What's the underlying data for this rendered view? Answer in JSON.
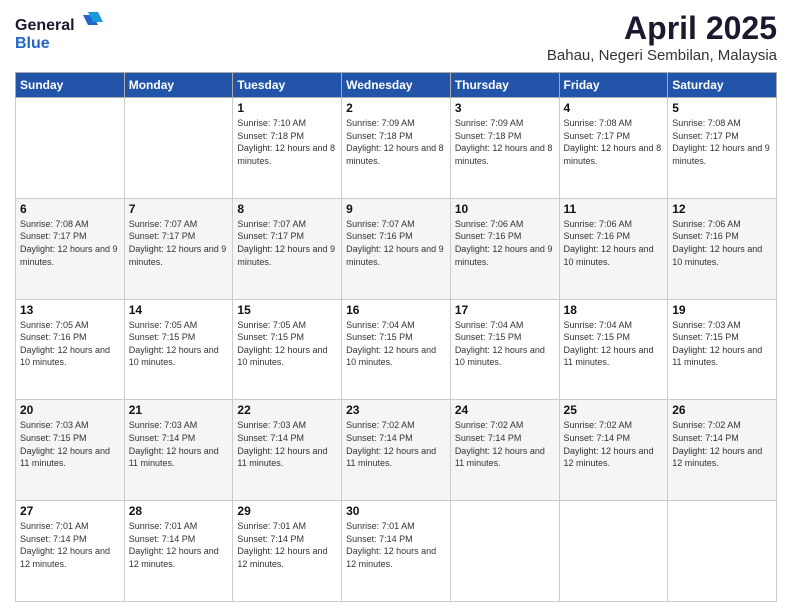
{
  "header": {
    "logo": {
      "general": "General",
      "blue": "Blue"
    },
    "title": "April 2025",
    "subtitle": "Bahau, Negeri Sembilan, Malaysia"
  },
  "calendar": {
    "days_of_week": [
      "Sunday",
      "Monday",
      "Tuesday",
      "Wednesday",
      "Thursday",
      "Friday",
      "Saturday"
    ],
    "weeks": [
      [
        {
          "day": "",
          "detail": ""
        },
        {
          "day": "",
          "detail": ""
        },
        {
          "day": "1",
          "detail": "Sunrise: 7:10 AM\nSunset: 7:18 PM\nDaylight: 12 hours and 8 minutes."
        },
        {
          "day": "2",
          "detail": "Sunrise: 7:09 AM\nSunset: 7:18 PM\nDaylight: 12 hours and 8 minutes."
        },
        {
          "day": "3",
          "detail": "Sunrise: 7:09 AM\nSunset: 7:18 PM\nDaylight: 12 hours and 8 minutes."
        },
        {
          "day": "4",
          "detail": "Sunrise: 7:08 AM\nSunset: 7:17 PM\nDaylight: 12 hours and 8 minutes."
        },
        {
          "day": "5",
          "detail": "Sunrise: 7:08 AM\nSunset: 7:17 PM\nDaylight: 12 hours and 9 minutes."
        }
      ],
      [
        {
          "day": "6",
          "detail": "Sunrise: 7:08 AM\nSunset: 7:17 PM\nDaylight: 12 hours and 9 minutes."
        },
        {
          "day": "7",
          "detail": "Sunrise: 7:07 AM\nSunset: 7:17 PM\nDaylight: 12 hours and 9 minutes."
        },
        {
          "day": "8",
          "detail": "Sunrise: 7:07 AM\nSunset: 7:17 PM\nDaylight: 12 hours and 9 minutes."
        },
        {
          "day": "9",
          "detail": "Sunrise: 7:07 AM\nSunset: 7:16 PM\nDaylight: 12 hours and 9 minutes."
        },
        {
          "day": "10",
          "detail": "Sunrise: 7:06 AM\nSunset: 7:16 PM\nDaylight: 12 hours and 9 minutes."
        },
        {
          "day": "11",
          "detail": "Sunrise: 7:06 AM\nSunset: 7:16 PM\nDaylight: 12 hours and 10 minutes."
        },
        {
          "day": "12",
          "detail": "Sunrise: 7:06 AM\nSunset: 7:16 PM\nDaylight: 12 hours and 10 minutes."
        }
      ],
      [
        {
          "day": "13",
          "detail": "Sunrise: 7:05 AM\nSunset: 7:16 PM\nDaylight: 12 hours and 10 minutes."
        },
        {
          "day": "14",
          "detail": "Sunrise: 7:05 AM\nSunset: 7:15 PM\nDaylight: 12 hours and 10 minutes."
        },
        {
          "day": "15",
          "detail": "Sunrise: 7:05 AM\nSunset: 7:15 PM\nDaylight: 12 hours and 10 minutes."
        },
        {
          "day": "16",
          "detail": "Sunrise: 7:04 AM\nSunset: 7:15 PM\nDaylight: 12 hours and 10 minutes."
        },
        {
          "day": "17",
          "detail": "Sunrise: 7:04 AM\nSunset: 7:15 PM\nDaylight: 12 hours and 10 minutes."
        },
        {
          "day": "18",
          "detail": "Sunrise: 7:04 AM\nSunset: 7:15 PM\nDaylight: 12 hours and 11 minutes."
        },
        {
          "day": "19",
          "detail": "Sunrise: 7:03 AM\nSunset: 7:15 PM\nDaylight: 12 hours and 11 minutes."
        }
      ],
      [
        {
          "day": "20",
          "detail": "Sunrise: 7:03 AM\nSunset: 7:15 PM\nDaylight: 12 hours and 11 minutes."
        },
        {
          "day": "21",
          "detail": "Sunrise: 7:03 AM\nSunset: 7:14 PM\nDaylight: 12 hours and 11 minutes."
        },
        {
          "day": "22",
          "detail": "Sunrise: 7:03 AM\nSunset: 7:14 PM\nDaylight: 12 hours and 11 minutes."
        },
        {
          "day": "23",
          "detail": "Sunrise: 7:02 AM\nSunset: 7:14 PM\nDaylight: 12 hours and 11 minutes."
        },
        {
          "day": "24",
          "detail": "Sunrise: 7:02 AM\nSunset: 7:14 PM\nDaylight: 12 hours and 11 minutes."
        },
        {
          "day": "25",
          "detail": "Sunrise: 7:02 AM\nSunset: 7:14 PM\nDaylight: 12 hours and 12 minutes."
        },
        {
          "day": "26",
          "detail": "Sunrise: 7:02 AM\nSunset: 7:14 PM\nDaylight: 12 hours and 12 minutes."
        }
      ],
      [
        {
          "day": "27",
          "detail": "Sunrise: 7:01 AM\nSunset: 7:14 PM\nDaylight: 12 hours and 12 minutes."
        },
        {
          "day": "28",
          "detail": "Sunrise: 7:01 AM\nSunset: 7:14 PM\nDaylight: 12 hours and 12 minutes."
        },
        {
          "day": "29",
          "detail": "Sunrise: 7:01 AM\nSunset: 7:14 PM\nDaylight: 12 hours and 12 minutes."
        },
        {
          "day": "30",
          "detail": "Sunrise: 7:01 AM\nSunset: 7:14 PM\nDaylight: 12 hours and 12 minutes."
        },
        {
          "day": "",
          "detail": ""
        },
        {
          "day": "",
          "detail": ""
        },
        {
          "day": "",
          "detail": ""
        }
      ]
    ]
  }
}
